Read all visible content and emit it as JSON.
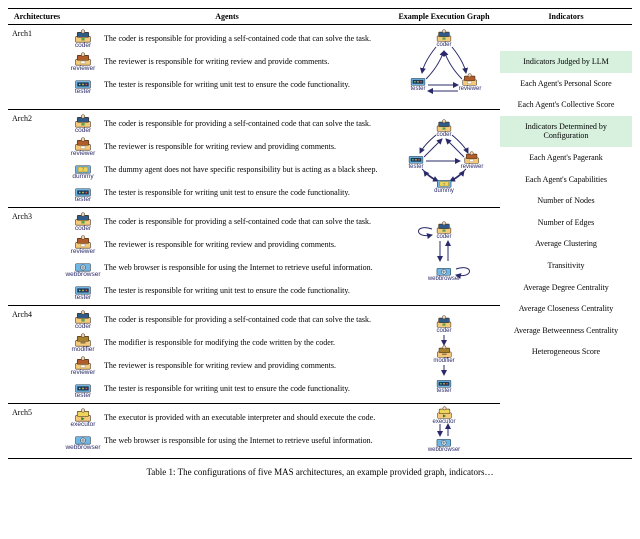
{
  "headers": {
    "architectures": "Architectures",
    "agents": "Agents",
    "graph": "Example Execution Graph",
    "indicators": "Indicators"
  },
  "architectures": [
    {
      "name": "Arch1",
      "agents": [
        {
          "role": "coder",
          "kind": "coder",
          "desc": "The coder is responsible for providing a self-contained code that can solve the task."
        },
        {
          "role": "reviewer",
          "kind": "reviewer",
          "desc": "The reviewer is responsible for writing review and provide comments."
        },
        {
          "role": "tester",
          "kind": "tester",
          "desc": "The tester is responsible for writing unit test to ensure the code functionality."
        }
      ]
    },
    {
      "name": "Arch2",
      "agents": [
        {
          "role": "coder",
          "kind": "coder",
          "desc": "The coder is responsible for providing a self-contained code that can solve the task."
        },
        {
          "role": "reviewer",
          "kind": "reviewer",
          "desc": "The reviewer is responsible for writing review and providing comments."
        },
        {
          "role": "dummy",
          "kind": "dummy",
          "desc": "The dummy agent does not have specific responsibility but is acting as a black sheep."
        },
        {
          "role": "tester",
          "kind": "tester",
          "desc": "The tester is responsible for writing unit test to ensure the code functionality."
        }
      ]
    },
    {
      "name": "Arch3",
      "agents": [
        {
          "role": "coder",
          "kind": "coder",
          "desc": "The coder is responsible for providing a self-contained code that can solve the task."
        },
        {
          "role": "reviewer",
          "kind": "reviewer",
          "desc": "The reviewer is responsible for writing review and providing comments."
        },
        {
          "role": "webbrowser",
          "kind": "web",
          "desc": "The web browser is responsible for using the Internet to retrieve useful information."
        },
        {
          "role": "tester",
          "kind": "tester",
          "desc": "The tester is responsible for writing unit test to ensure the code functionality."
        }
      ]
    },
    {
      "name": "Arch4",
      "agents": [
        {
          "role": "coder",
          "kind": "coder",
          "desc": "The coder is responsible for providing a self-contained code that can solve the task."
        },
        {
          "role": "modifier",
          "kind": "modifier",
          "desc": "The modifier is responsible for modifying the code written by the coder."
        },
        {
          "role": "reviewer",
          "kind": "reviewer",
          "desc": "The reviewer is responsible for writing review and providing comments."
        },
        {
          "role": "tester",
          "kind": "tester",
          "desc": "The tester is responsible for writing unit test to ensure the code functionality."
        }
      ]
    },
    {
      "name": "Arch5",
      "agents": [
        {
          "role": "executor",
          "kind": "executor",
          "desc": "The executor is provided with an executable interpreter and should execute the code."
        },
        {
          "role": "webbrowser",
          "kind": "web",
          "desc": "The web browser is responsible for using the Internet to retrieve useful information."
        }
      ]
    }
  ],
  "indicators": [
    {
      "label": "Indicators Judged by LLM",
      "head": true
    },
    {
      "label": "Each Agent's Personal Score",
      "head": false
    },
    {
      "label": "Each Agent's Collective Score",
      "head": false
    },
    {
      "label": "Indicators Determined by Configuration",
      "head": true
    },
    {
      "label": "Each Agent's Pagerank",
      "head": false
    },
    {
      "label": "Each Agent's Capabilities",
      "head": false
    },
    {
      "label": "Number of Nodes",
      "head": false
    },
    {
      "label": "Number of Edges",
      "head": false
    },
    {
      "label": "Average Clustering",
      "head": false
    },
    {
      "label": "Transitivity",
      "head": false
    },
    {
      "label": "Average Degree Centrality",
      "head": false
    },
    {
      "label": "Average Closeness Centrality",
      "head": false
    },
    {
      "label": "Average Betweenness Centrality",
      "head": false
    },
    {
      "label": "Heterogeneous Score",
      "head": false
    }
  ],
  "caption_prefix": "Table 1: ",
  "caption_rest": "The configurations of five MAS architectures, an example provided graph, indicators…",
  "icon_defs": {
    "coder": {
      "body": "#f4c97a",
      "extra": "#5aa34a"
    },
    "reviewer": {
      "body": "#f4c97a",
      "extra": "#d67c3b"
    },
    "tester": {
      "body": "#6fb7e5",
      "extra": "#ffffff"
    },
    "dummy": {
      "body": "#6fb7e5",
      "extra": "#efd45b"
    },
    "web": {
      "body": "#6fb7e5",
      "extra": "#ffffff"
    },
    "modifier": {
      "body": "#f4c97a",
      "extra": "#a8812e"
    },
    "executor": {
      "body": "#f4c97a",
      "extra": "#efd45b"
    }
  }
}
